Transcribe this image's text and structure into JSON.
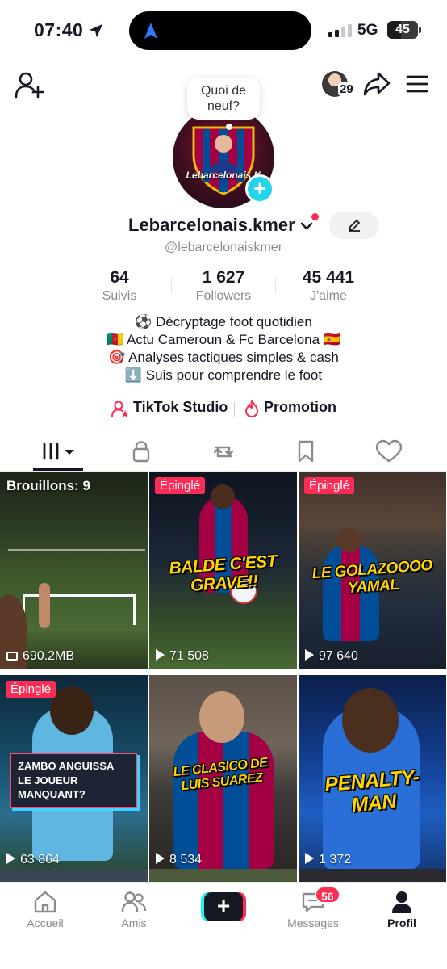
{
  "status_bar": {
    "time": "07:40",
    "network": "5G",
    "battery": "45",
    "battery_level": 0.45
  },
  "top_nav": {
    "friends_count": "29",
    "bubble_text": "Quoi de neuf?"
  },
  "profile": {
    "avatar_brand": "Lebarcelonais.K",
    "username": "Lebarcelonais.kmer",
    "handle": "@lebarcelonaiskmer",
    "stats": [
      {
        "value": "64",
        "label": "Suivis"
      },
      {
        "value": "1 627",
        "label": "Followers"
      },
      {
        "value": "45 441",
        "label": "J'aime"
      }
    ],
    "bio": [
      "⚽ Décryptage foot quotidien",
      "🇨🇲 Actu Cameroun & Fc Barcelona 🇪🇸",
      "🎯 Analyses tactiques simples & cash",
      "⬇️ Suis pour comprendre le foot"
    ],
    "studio_label": "TikTok Studio",
    "promo_label": "Promotion"
  },
  "tabs": [
    {
      "icon": "grid-icon",
      "active": true
    },
    {
      "icon": "lock-icon"
    },
    {
      "icon": "repost-icon"
    },
    {
      "icon": "bookmark-icon"
    },
    {
      "icon": "heart-icon"
    }
  ],
  "videos": [
    {
      "badge": "Brouillons: 9",
      "views": "690.2MB",
      "caption": ""
    },
    {
      "badge": "Épinglé",
      "views": "71 508",
      "caption": "BALDE C'EST GRAVE!!"
    },
    {
      "badge": "Épinglé",
      "views": "97 640",
      "caption": "LE GOLAZOOOO YAMAL"
    },
    {
      "badge": "Épinglé",
      "views": "63 864",
      "caption": "ZAMBO ANGUISSA\nLE JOUEUR MANQUANT?"
    },
    {
      "badge": "",
      "views": "8 534",
      "caption": "LE CLASICO DE\nLUIS SUAREZ"
    },
    {
      "badge": "",
      "views": "1 372",
      "caption": "PENALTY-MAN"
    }
  ],
  "bottom_nav": {
    "home": "Accueil",
    "friends": "Amis",
    "messages": "Messages",
    "messages_badge": "56",
    "profile": "Profil"
  },
  "colors": {
    "accent": "#fe2c55",
    "cyan": "#25f4ee",
    "text": "#161823",
    "muted": "#8a8b91"
  }
}
